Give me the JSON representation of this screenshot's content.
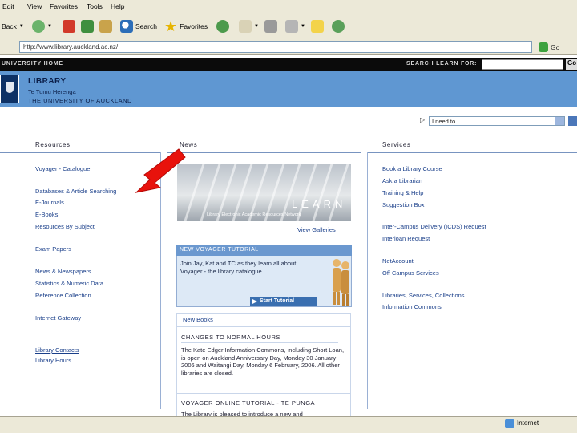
{
  "menu": [
    "Edit",
    "View",
    "Favorites",
    "Tools",
    "Help"
  ],
  "toolbar": {
    "back": "Back",
    "search": "Search",
    "favorites": "Favorites"
  },
  "address": {
    "url": "http://www.library.auckland.ac.nz/",
    "go": "Go"
  },
  "uo_bar": {
    "home": "UNIVERSITY HOME",
    "search_label": "SEARCH LEARN FOR:",
    "go": "Go"
  },
  "banner": {
    "title": "LIBRARY",
    "subtitle": "Te Tumu Herenga",
    "university": "THE UNIVERSITY OF AUCKLAND"
  },
  "need_select": "I need to ...",
  "columns": {
    "resources": "Resources",
    "news": "News",
    "services": "Services"
  },
  "resources": {
    "group1": [
      "Voyager - Catalogue",
      "Databases & Article Searching",
      "E-Journals",
      "E-Books",
      "Resources By Subject"
    ],
    "group2": [
      "Exam Papers"
    ],
    "group3": [
      "News & Newspapers",
      "Statistics & Numeric Data",
      "Reference Collection"
    ],
    "group4": [
      "Internet Gateway"
    ],
    "group5": [
      "Library Contacts",
      "Library Hours"
    ]
  },
  "news": {
    "learn_word": "LEARN",
    "learn_caption": "Library Electronic Academic Resources Network",
    "view_galleries": "View Galleries",
    "tutorial_head": "NEW VOYAGER TUTORIAL",
    "tutorial_text": "Join Jay, Kat and TC as they learn all about Voyager - the library catalogue...",
    "start_tutorial": "Start Tutorial",
    "new_books": "New Books",
    "item1_head": "CHANGES TO NORMAL HOURS",
    "item1_body": "The Kate Edger Information Commons, including Short Loan, is open on Auckland Anniversary Day, Monday 30 January 2006 and Waitangi Day, Monday 6 February, 2006. All other libraries are closed.",
    "item2_head": "VOYAGER ONLINE TUTORIAL - TE PUNGA",
    "item2_body": "The Library is pleased to introduce a new and"
  },
  "services": {
    "group1": [
      "Book a Library Course",
      "Ask a Librarian",
      "Training & Help",
      "Suggestion Box"
    ],
    "group2": [
      "Inter-Campus Delivery (ICDS) Request",
      "Interloan Request"
    ],
    "group3": [
      "NetAccount",
      "Off Campus Services"
    ],
    "group4": [
      "Libraries, Services, Collections",
      "Information Commons"
    ]
  },
  "status": {
    "zone": "Internet"
  },
  "colors": {
    "banner": "#5f97d2",
    "link": "#1a3f8a",
    "arrow": "#e8120c"
  }
}
